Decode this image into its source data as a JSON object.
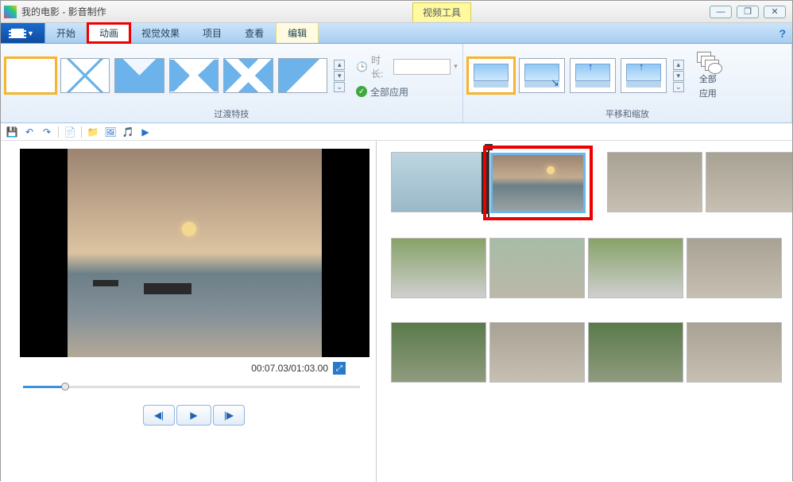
{
  "window": {
    "title": "我的电影 - 影音制作",
    "contextual_tab_label": "视频工具",
    "buttons": {
      "min": "—",
      "max": "❐",
      "close": "✕"
    }
  },
  "tabs": {
    "file_aria": "文件菜单",
    "items": [
      "开始",
      "动画",
      "视觉效果",
      "项目",
      "查看"
    ],
    "active": "动画",
    "highlighted": "动画",
    "edit": "编辑",
    "help": "?"
  },
  "ribbon": {
    "transitions": {
      "label": "过渡特技",
      "duration_label": "时长:",
      "duration_value": "",
      "apply_all": "全部应用"
    },
    "panzoom": {
      "label": "平移和缩放",
      "apply_all_line1": "全部",
      "apply_all_line2": "应用"
    }
  },
  "preview": {
    "time": "00:07.03/01:03.00"
  },
  "qat": {
    "save": "💾",
    "undo": "↶",
    "redo": "↷",
    "new": "📄",
    "i1": "📁",
    "i2": "🖼",
    "i3": "🎵",
    "i4": "▶"
  }
}
